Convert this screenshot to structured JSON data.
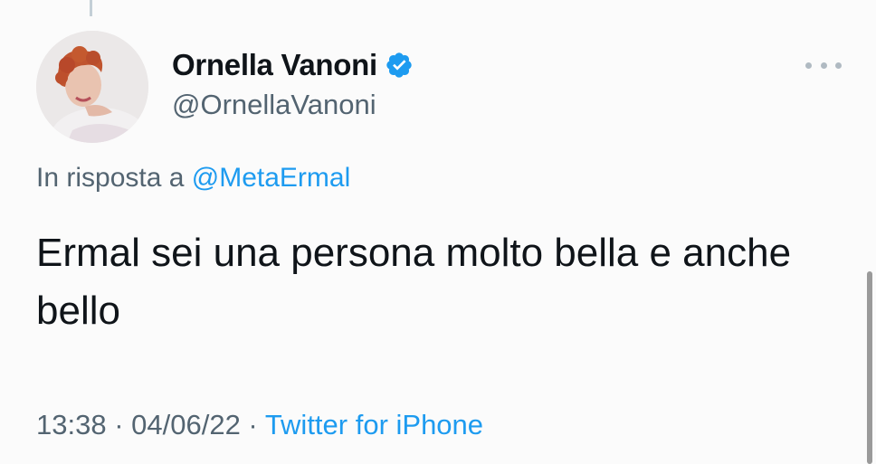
{
  "tweet": {
    "author": {
      "display_name": "Ornella Vanoni",
      "handle": "@OrnellaVanoni",
      "verified": true
    },
    "reply": {
      "prefix": "In risposta a ",
      "mention": "@MetaErmal"
    },
    "text": "Ermal sei una persona molto bella e anche bello",
    "meta": {
      "time": "13:38",
      "separator": " · ",
      "date": "04/06/22",
      "source": "Twitter for iPhone"
    }
  },
  "icons": {
    "verified": "verified-badge-icon",
    "more": "more-options-icon"
  },
  "colors": {
    "accent": "#1d9bf0",
    "secondary_text": "#536471",
    "primary_text": "#0f1419"
  }
}
